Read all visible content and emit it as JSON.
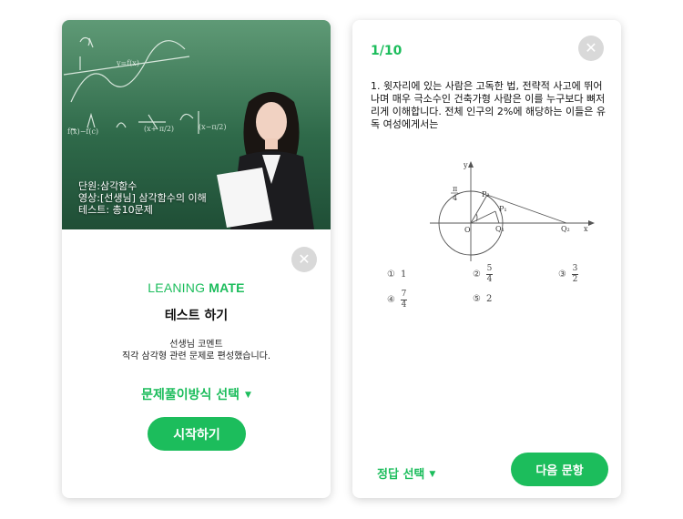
{
  "lesson_card": {
    "info_lines": [
      "단원:삼각함수",
      "영상:[선생님] 삼각함수의 이해",
      "테스트: 총10문제"
    ],
    "close_icon": "close-icon",
    "brand_light": "LEANING",
    "brand_bold": "MATE",
    "title": "테스트 하기",
    "comment_title": "선생님 코멘트",
    "comment_text": "직각 삼각형 관련 문제로 편성했습니다.",
    "method_label": "문제풀이방식 선택",
    "start_label": "시작하기"
  },
  "question_card": {
    "counter": "1/10",
    "close_icon": "close-icon",
    "question_text": "1. 윗자리에 있는 사람은 고독한 법, 전략적 사고에 뛰어나며 매우 극소수인 건축가형 사람은 이를 누구보다 뼈저리게 이해합니다. 전체 인구의 2%에 해당하는 이들은 유독 여성에게서는",
    "figure_labels": {
      "y": "y",
      "x": "x",
      "origin": "O",
      "angle_num": "π",
      "angle_den": "4",
      "p2": "P₂",
      "p1": "P₁",
      "q1": "Q₁",
      "q2": "Q₂"
    },
    "choices": [
      {
        "num": "①",
        "value": "1"
      },
      {
        "num": "②",
        "frac_num": "5",
        "frac_den": "4"
      },
      {
        "num": "③",
        "frac_num": "3",
        "frac_den": "2"
      },
      {
        "num": "④",
        "frac_num": "7",
        "frac_den": "4"
      },
      {
        "num": "⑤",
        "value": "2"
      }
    ],
    "answer_label": "정답 선택",
    "next_label": "다음 문항"
  },
  "colors": {
    "accent": "#1cbd5c",
    "board": "#3d7d59",
    "close_bg": "#d9d9d9"
  }
}
